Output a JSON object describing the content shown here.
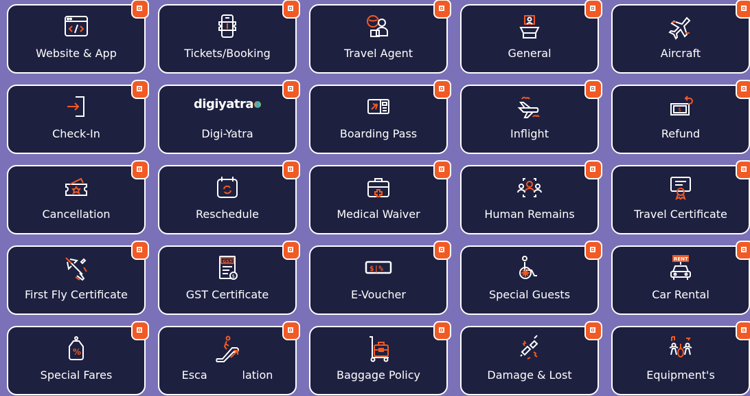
{
  "colors": {
    "background": "#7b71b8",
    "tile": "#1e2040",
    "accent": "#f15a24",
    "outline": "#ffffff"
  },
  "tiles": [
    {
      "label": "Website & App",
      "icon": "browser-code-icon"
    },
    {
      "label": "Tickets/Booking",
      "icon": "mobile-ticket-icon"
    },
    {
      "label": "Travel Agent",
      "icon": "travel-agent-icon"
    },
    {
      "label": "General",
      "icon": "info-desk-icon"
    },
    {
      "label": "Aircraft",
      "icon": "airplane-icon"
    },
    {
      "label": "Check-In",
      "icon": "check-in-icon"
    },
    {
      "label": "Digi-Yatra",
      "icon": "digiyatra-logo",
      "logo_text": "digiyatra"
    },
    {
      "label": "Boarding Pass",
      "icon": "boarding-pass-icon"
    },
    {
      "label": "Inflight",
      "icon": "inflight-plane-icon"
    },
    {
      "label": "Refund",
      "icon": "refund-money-icon"
    },
    {
      "label": "Cancellation",
      "icon": "cancel-ticket-icon"
    },
    {
      "label": "Reschedule",
      "icon": "calendar-reschedule-icon"
    },
    {
      "label": "Medical Waiver",
      "icon": "medical-kit-icon"
    },
    {
      "label": "Human Remains",
      "icon": "people-group-icon"
    },
    {
      "label": "Travel Certificate",
      "icon": "certificate-icon"
    },
    {
      "label": "First Fly Certificate",
      "icon": "plane-takeoff-icon"
    },
    {
      "label": "GST Certificate",
      "icon": "gst-document-icon",
      "icon_text": "GST"
    },
    {
      "label": "E-Voucher",
      "icon": "voucher-icon",
      "icon_text": "$|%"
    },
    {
      "label": "Special Guests",
      "icon": "wheelchair-icon"
    },
    {
      "label": "Car Rental",
      "icon": "car-rental-icon",
      "icon_text": "RENT"
    },
    {
      "label": "Special Fares",
      "icon": "discount-tag-icon",
      "icon_text": "%"
    },
    {
      "label": "Esca          lation",
      "icon": "escalator-icon"
    },
    {
      "label": "Baggage Policy",
      "icon": "luggage-trolley-icon"
    },
    {
      "label": "Damage & Lost",
      "icon": "broken-item-icon"
    },
    {
      "label": "Equipment's",
      "icon": "music-people-icon"
    }
  ]
}
